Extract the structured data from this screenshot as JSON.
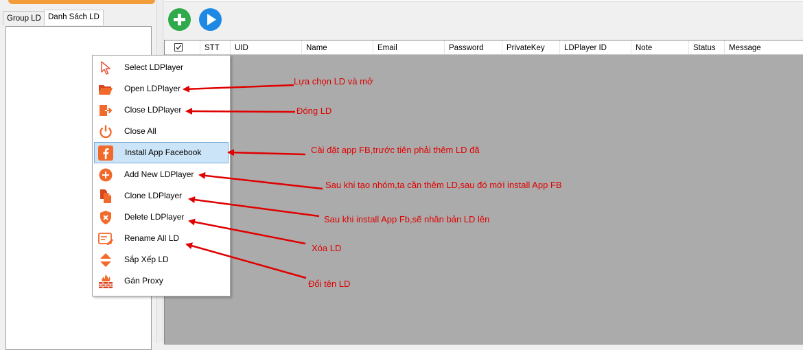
{
  "tabs": [
    "Group LD",
    "Danh Sách LD"
  ],
  "toolbar": {
    "add_icon": "plus-circle-icon",
    "run_icon": "play-circle-icon"
  },
  "grid": {
    "columns": [
      "STT",
      "UID",
      "Name",
      "Email",
      "Password",
      "PrivateKey",
      "LDPlayer ID",
      "Note",
      "Status",
      "Message"
    ]
  },
  "menu": {
    "items": [
      {
        "label": "Select LDPlayer",
        "icon": "cursor-icon"
      },
      {
        "label": "Open LDPlayer",
        "icon": "folder-open-icon"
      },
      {
        "label": "Close LDPlayer",
        "icon": "exit-icon"
      },
      {
        "label": "Close All",
        "icon": "power-icon"
      },
      {
        "label": "Install App Facebook",
        "icon": "facebook-icon"
      },
      {
        "label": "Add New LDPlayer",
        "icon": "add-circle-icon"
      },
      {
        "label": "Clone LDPlayer",
        "icon": "copy-file-icon"
      },
      {
        "label": "Delete LDPlayer",
        "icon": "shield-delete-icon"
      },
      {
        "label": "Rename All LD",
        "icon": "rename-icon"
      },
      {
        "label": "Sắp Xếp LD",
        "icon": "sort-icon"
      },
      {
        "label": "Gán Proxy",
        "icon": "firewall-icon"
      }
    ]
  },
  "annotations": [
    "Lựa chọn LD và mở",
    "Đóng LD",
    "Cài đặt app FB,trước tiên phải thêm LD đã",
    "Sau khi tạo nhóm,ta cần thêm LD,sau đó mới install App FB",
    "Sau khi install App Fb,sẽ nhân bản LD lên",
    "Xóa LD",
    "Đổi tên LD"
  ],
  "colors": {
    "annotation": "#e00000",
    "menu_highlight": "#cce4f7",
    "grid_bg": "#ababab"
  }
}
